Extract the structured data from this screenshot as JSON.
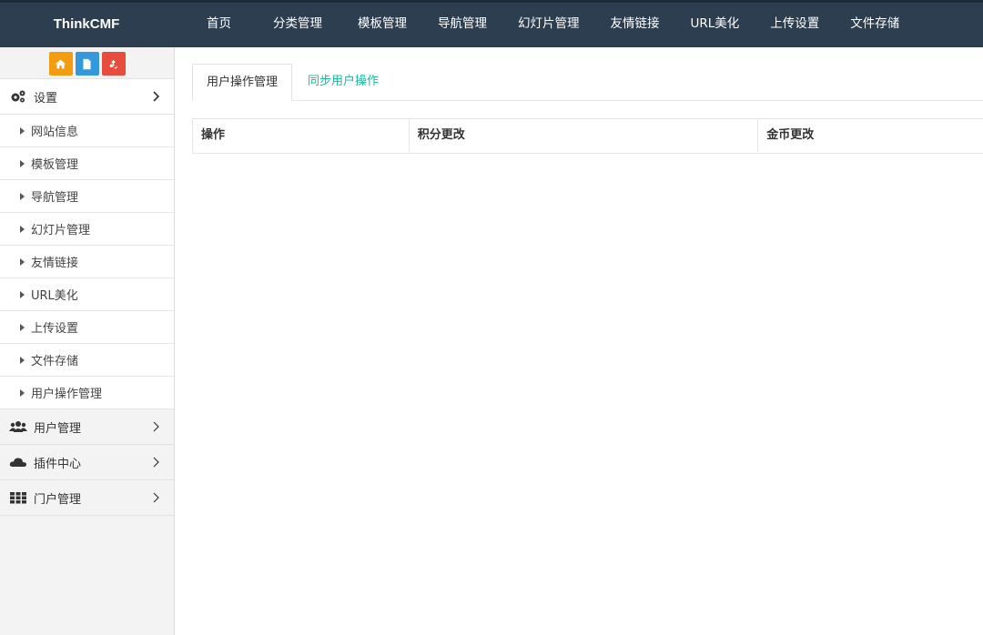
{
  "app": {
    "brand": "ThinkCMF"
  },
  "topnav": [
    "首页",
    "分类管理",
    "模板管理",
    "导航管理",
    "幻灯片管理",
    "友情链接",
    "URL美化",
    "上传设置",
    "文件存储"
  ],
  "sidebar": {
    "shortcuts": [
      {
        "icon": "home-icon",
        "color": "#f39c12"
      },
      {
        "icon": "file-icon",
        "color": "#3498db"
      },
      {
        "icon": "recycle-icon",
        "color": "#e74c3c"
      }
    ],
    "settings": {
      "label": "设置",
      "icon": "gears-icon",
      "items": [
        "网站信息",
        "模板管理",
        "导航管理",
        "幻灯片管理",
        "友情链接",
        "URL美化",
        "上传设置",
        "文件存储",
        "用户操作管理"
      ]
    },
    "menus": [
      {
        "label": "用户管理",
        "icon": "users-icon"
      },
      {
        "label": "插件中心",
        "icon": "cloud-icon"
      },
      {
        "label": "门户管理",
        "icon": "grid-icon"
      }
    ]
  },
  "main": {
    "tabs": [
      {
        "label": "用户操作管理",
        "active": true
      },
      {
        "label": "同步用户操作",
        "active": false
      }
    ],
    "table": {
      "columns": [
        "操作",
        "积分更改",
        "金币更改"
      ]
    }
  },
  "colors": {
    "topbar": "#2c3e50",
    "accent": "#1abc9c"
  }
}
